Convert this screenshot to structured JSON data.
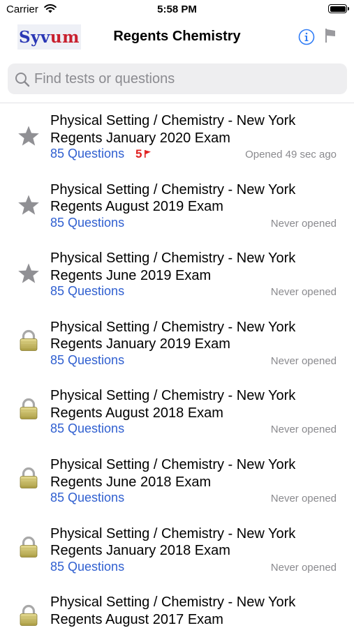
{
  "status_bar": {
    "carrier": "Carrier",
    "time": "5:58 PM"
  },
  "nav": {
    "logo_text_a": "Syv",
    "logo_text_b": "um",
    "title": "Regents Chemistry"
  },
  "icons": {
    "info": "info-icon",
    "flag": "flag-icon",
    "search": "search-icon",
    "star": "star-icon",
    "lock": "lock-icon"
  },
  "colors": {
    "link_blue": "#2f5fd0",
    "flag_red": "#e02020",
    "info_blue": "#2f7cf6",
    "muted_gray": "#8a8a8e"
  },
  "search": {
    "placeholder": "Find tests or questions"
  },
  "exams": [
    {
      "title_line1": "Physical Setting / Chemistry - New York",
      "title_line2": "Regents January 2020 Exam",
      "questions": "85 Questions",
      "flags": "5",
      "opened": "Opened 49 sec ago",
      "icon": "star"
    },
    {
      "title_line1": "Physical Setting / Chemistry - New York",
      "title_line2": "Regents August 2019 Exam",
      "questions": "85 Questions",
      "flags": "",
      "opened": "Never opened",
      "icon": "star"
    },
    {
      "title_line1": "Physical Setting / Chemistry - New York",
      "title_line2": "Regents June 2019 Exam",
      "questions": "85 Questions",
      "flags": "",
      "opened": "Never opened",
      "icon": "star"
    },
    {
      "title_line1": "Physical Setting / Chemistry - New York",
      "title_line2": "Regents January 2019 Exam",
      "questions": "85 Questions",
      "flags": "",
      "opened": "Never opened",
      "icon": "lock"
    },
    {
      "title_line1": "Physical Setting / Chemistry - New York",
      "title_line2": "Regents August 2018 Exam",
      "questions": "85 Questions",
      "flags": "",
      "opened": "Never opened",
      "icon": "lock"
    },
    {
      "title_line1": "Physical Setting / Chemistry - New York",
      "title_line2": "Regents June 2018 Exam",
      "questions": "85 Questions",
      "flags": "",
      "opened": "Never opened",
      "icon": "lock"
    },
    {
      "title_line1": "Physical Setting / Chemistry - New York",
      "title_line2": "Regents January 2018 Exam",
      "questions": "85 Questions",
      "flags": "",
      "opened": "Never opened",
      "icon": "lock"
    },
    {
      "title_line1": "Physical Setting / Chemistry - New York",
      "title_line2": "Regents August 2017 Exam",
      "questions": "",
      "flags": "",
      "opened": "",
      "icon": "lock"
    }
  ]
}
